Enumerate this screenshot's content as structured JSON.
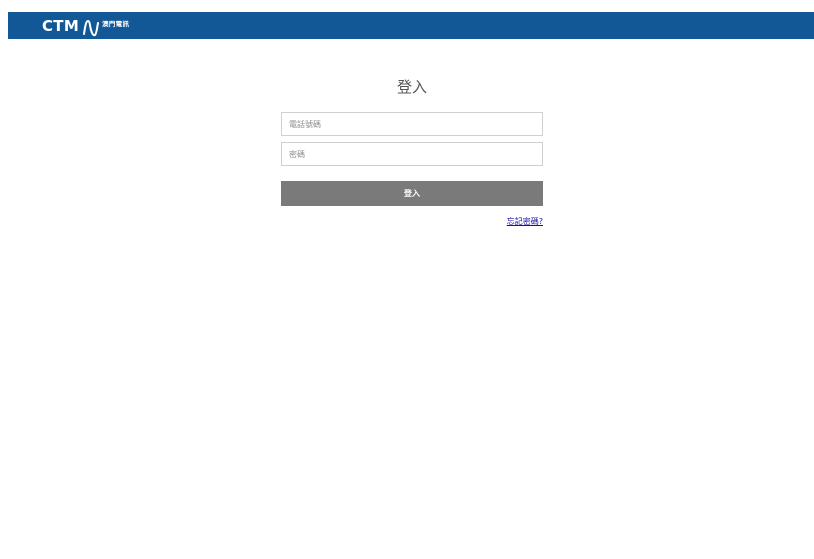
{
  "header": {
    "logo_text": "CTM",
    "logo_chinese": "澳門電訊",
    "background": "#135896"
  },
  "login": {
    "title": "登入",
    "phone_placeholder": "電話號碼",
    "password_placeholder": "密碼",
    "submit_label": "登入",
    "forgot_label": "忘記密碼?"
  }
}
